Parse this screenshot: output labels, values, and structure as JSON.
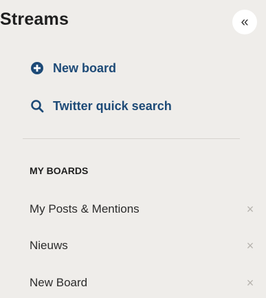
{
  "header": {
    "title": "Streams",
    "collapse_glyph": "«",
    "collapse_icon": "double-chevron-left-icon"
  },
  "actions": {
    "new_board": {
      "label": "New board",
      "icon": "plus-circle-icon"
    },
    "twitter_search": {
      "label": "Twitter quick search",
      "icon": "search-icon"
    }
  },
  "boards_section": {
    "title": "MY BOARDS",
    "items": [
      {
        "label": "My Posts & Mentions",
        "remove_glyph": "×"
      },
      {
        "label": "Nieuws",
        "remove_glyph": "×"
      },
      {
        "label": "New Board",
        "remove_glyph": "×"
      }
    ]
  },
  "colors": {
    "background": "#efedea",
    "action_text": "#1d4a77",
    "remove_icon": "#b6b3ae"
  }
}
